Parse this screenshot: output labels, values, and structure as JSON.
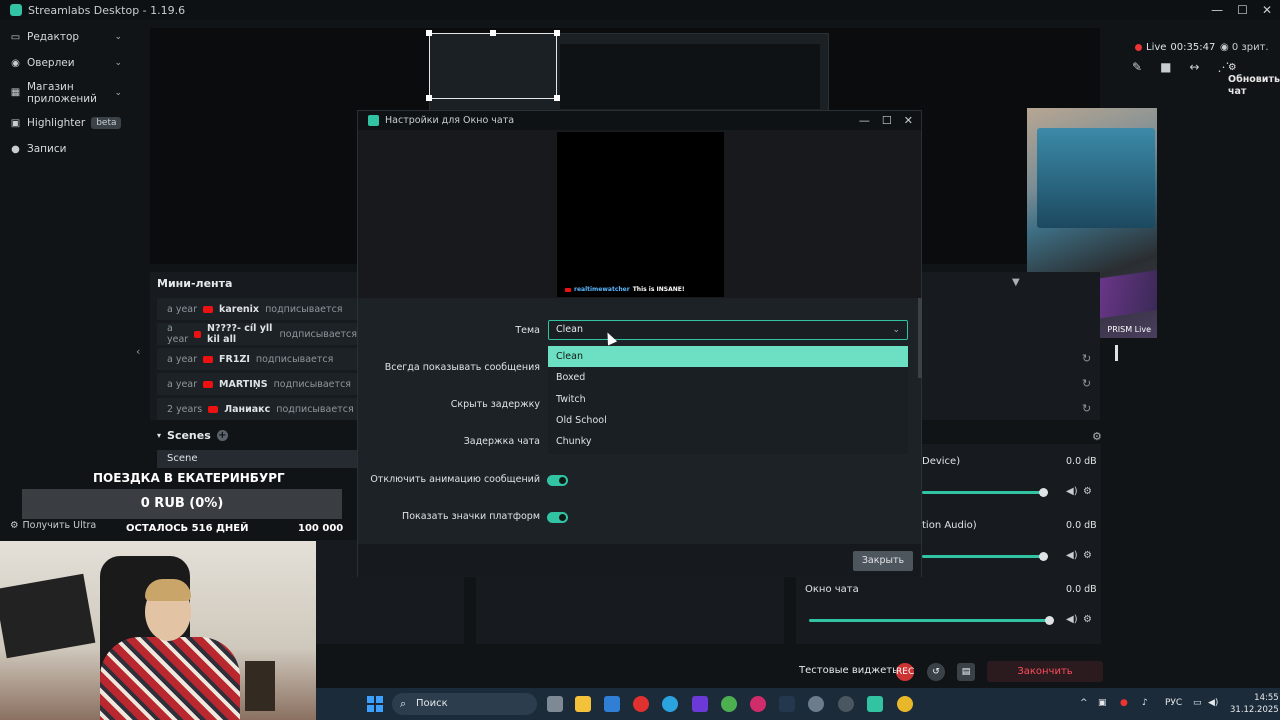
{
  "app": {
    "title": "Streamlabs Desktop - 1.19.6",
    "window_controls": [
      "—",
      "☐",
      "✕"
    ]
  },
  "nav": {
    "items": [
      {
        "label": "Редактор",
        "icon": "editor-icon"
      },
      {
        "label": "Оверлеи",
        "icon": "overlays-icon"
      },
      {
        "label": "Магазин приложений",
        "icon": "app-store-icon"
      },
      {
        "label": "Highlighter",
        "badge": "beta",
        "icon": "highlighter-icon"
      },
      {
        "label": "Записи",
        "icon": "recordings-icon"
      }
    ]
  },
  "live": {
    "status": "Live",
    "time": "00:35:47",
    "viewers": "0 зрит.",
    "refresh_chat": "Обновить чат"
  },
  "cam_right_label": "PRISM Live",
  "minifeed": {
    "title": "Мини-лента",
    "rows": [
      {
        "time": "a year",
        "name": "karenix",
        "action": "подписывается"
      },
      {
        "time": "a year",
        "name": "N????- cíl yll kil all",
        "action": "подписывается"
      },
      {
        "time": "a year",
        "name": "FR1ZI",
        "action": "подписывается"
      },
      {
        "time": "a year",
        "name": "MARTIŅS",
        "action": "подписывается"
      },
      {
        "time": "2 years",
        "name": "Ланиакс",
        "action": "подписывается"
      }
    ]
  },
  "scenes": {
    "title": "Scenes",
    "items": [
      "Scene"
    ]
  },
  "goal": {
    "title": "ПОЕЗДКА В ЕКАТЕРИНБУРГ",
    "progress": "0 RUB (0%)",
    "remaining": "ОСТАЛОСЬ 516 ДНЕЙ",
    "target": "100 000",
    "ultra": "Получить Ultra"
  },
  "mixer": {
    "sources": [
      {
        "label": "Device)",
        "db": "0.0 dB",
        "level": 0.95
      },
      {
        "label": "tion Audio)",
        "db": "0.0 dB",
        "level": 0.95
      },
      {
        "label": "Окно чата",
        "db": "0.0 dB",
        "level": 1.0
      }
    ]
  },
  "bottom": {
    "test_widgets": "Тестовые виджеты",
    "rec": "REC",
    "end_stream": "Закончить трансляцию"
  },
  "taskbar": {
    "search": "Поиск",
    "lang": "РУС",
    "time": "14:55",
    "date": "31.12.2025"
  },
  "modal": {
    "title": "Настройки для Окно чата",
    "chat_preview": {
      "user": "realtimewatcher",
      "text": "This is INSANE!"
    },
    "fields": {
      "theme_label": "Тема",
      "theme_value": "Clean",
      "always_show_label": "Всегда показывать сообщения",
      "hide_delay_label": "Скрыть задержку",
      "chat_delay_label": "Задержка чата",
      "disable_anim_label": "Отключить анимацию сообщений",
      "show_badges_label": "Показать значки платформ"
    },
    "theme_options": [
      "Clean",
      "Boxed",
      "Twitch",
      "Old School",
      "Chunky"
    ],
    "close_label": "Закрыть"
  },
  "colors": {
    "accent": "#31c3a2",
    "accent_light": "#6de0c3",
    "live_red": "#ee3333",
    "danger": "#ff4d5e"
  }
}
